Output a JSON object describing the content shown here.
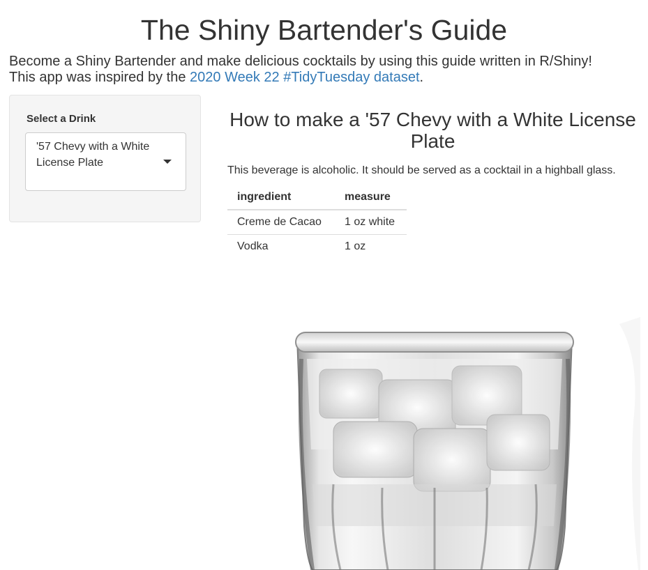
{
  "app": {
    "title": "The Shiny Bartender's Guide"
  },
  "intro": {
    "line1": "Become a Shiny Bartender and make delicious cocktails by using this guide written in R/Shiny!",
    "line2_prefix": "This app was inspired by the ",
    "link_text": "2020 Week 22 #TidyTuesday dataset",
    "line2_suffix": "."
  },
  "sidebar": {
    "select_label": "Select a Drink",
    "selected_value": "'57 Chevy with a White License Plate",
    "caret_icon": "caret-down-icon"
  },
  "main": {
    "title": "How to make a '57 Chevy with a White License Plate",
    "description": "This beverage is alcoholic. It should be served as a cocktail in a highball glass.",
    "table": {
      "headers": [
        "ingredient",
        "measure"
      ],
      "rows": [
        [
          "Creme de Cacao",
          "1 oz white"
        ],
        [
          "Vodka",
          "1 oz"
        ]
      ]
    }
  },
  "colors": {
    "link": "#337ab7",
    "text": "#333333",
    "sidebar_bg": "#f5f5f5"
  }
}
